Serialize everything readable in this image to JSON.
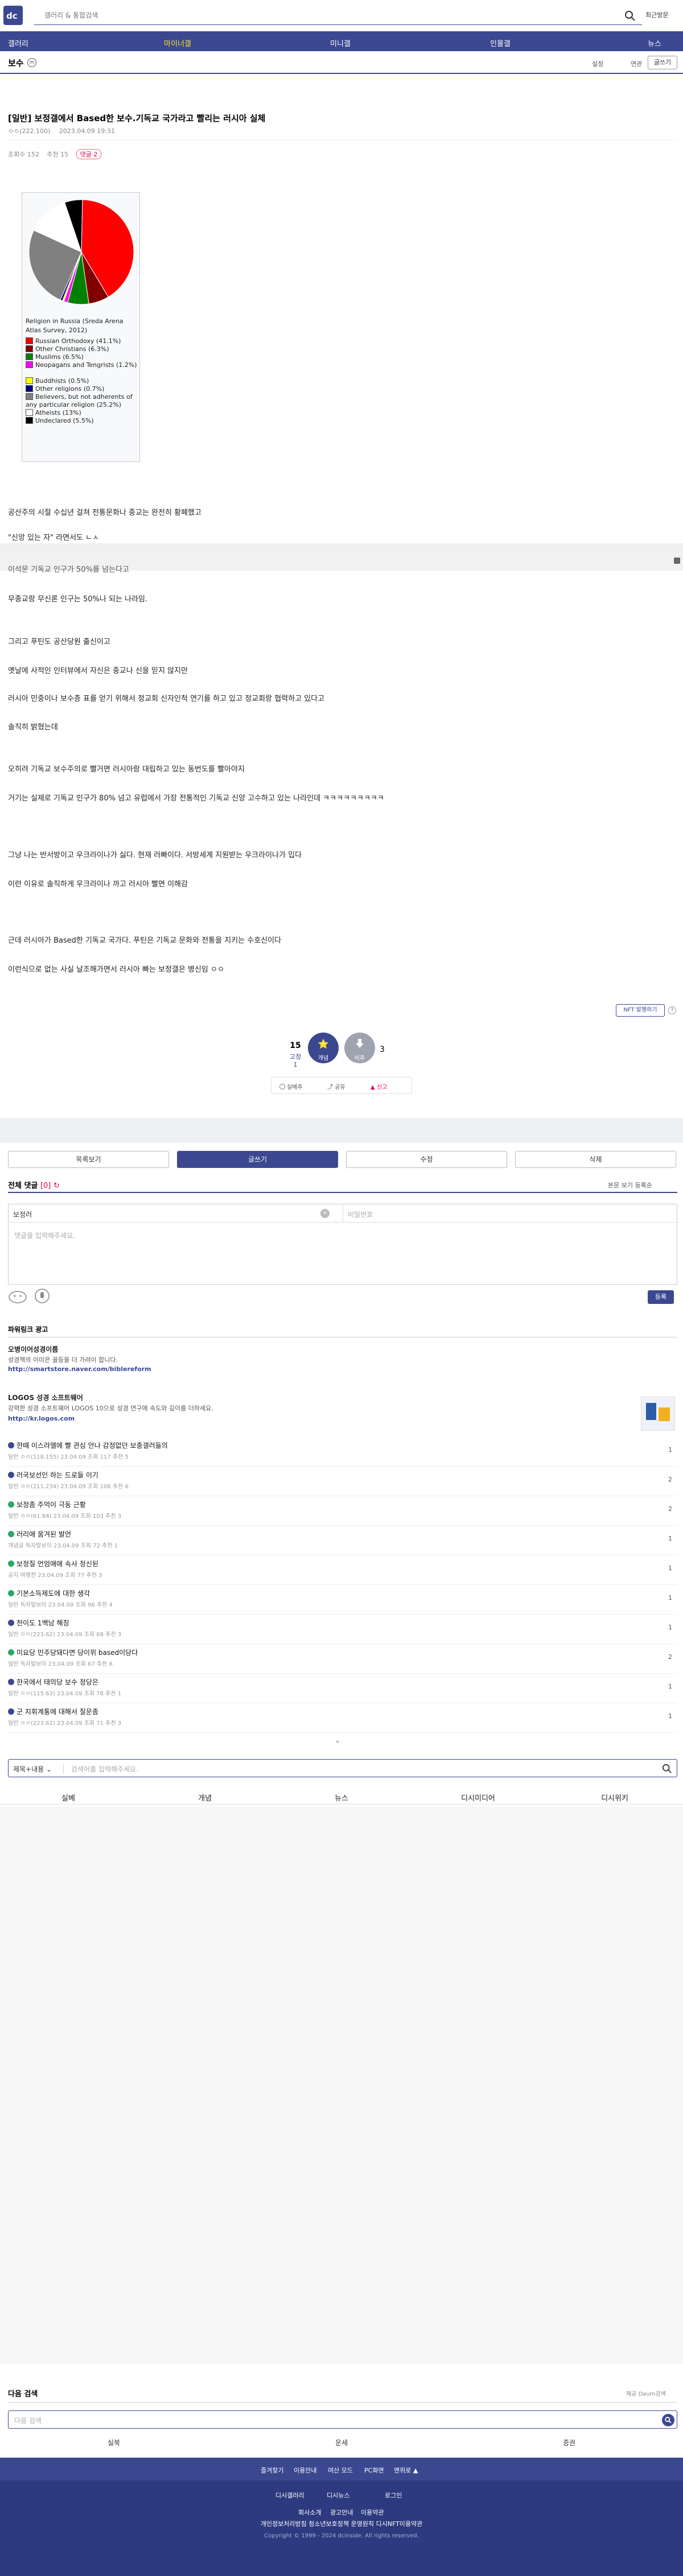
{
  "header": {
    "search_placeholder": "갤러리 & 통합검색",
    "recent": "최근방문"
  },
  "nav": [
    "갤러리",
    "마이너갤",
    "미니갤",
    "인물갤",
    "뉴스"
  ],
  "gallery": {
    "name": "보수",
    "setting": "설정",
    "view_mode": "연관",
    "write": "글쓰기"
  },
  "post": {
    "title": "[일반] 보정갤에서 Based한 보수.기독교 국가라고 빨리는 러시아 실체",
    "author": "ㅇㅇ(222.100)",
    "date": "2023.04.09 19:31",
    "views": "조회수 152",
    "recommend": "추천 15",
    "comments_chip": "댓글 2"
  },
  "figure": {
    "caption": "Religion in Russia (Sreda Arena Atlas Survey, 2012)",
    "legend": [
      {
        "label": "Russian Orthodoxy (41.1%)",
        "color": "#ff0000"
      },
      {
        "label": "Other Christians (6.3%)",
        "color": "#800000"
      },
      {
        "label": "Muslims (6.5%)",
        "color": "#008000"
      },
      {
        "label": "Neopagans and Tengrists (1.2%)",
        "color": "#ff00ff"
      },
      {
        "label": "Buddhists (0.5%)",
        "color": "#ffff00"
      },
      {
        "label": "Other religions (0.7%)",
        "color": "#000080"
      },
      {
        "label": "Believers, but not adherents of any particular religion (25.2%)",
        "color": "#808080"
      },
      {
        "label": "Atheists (13%)",
        "color": "#ffffff"
      },
      {
        "label": "Undeclared (5.5%)",
        "color": "#000000"
      }
    ]
  },
  "body": [
    "공산주의 시절 수십년 걸쳐 전통문화나 종교는 완전히 황폐했고",
    "\"신앙 있는 자\" 라면서도 ㄴㅅ",
    "이석문 기독교 인구가 50%를 넘는다고",
    "무종교랑 무신론 인구는 50%나 되는 나라임.",
    "그리고 푸틴도 공산당원 출신이고",
    "옛날에 사적인 인터뷰에서 자신은 종교나 신을 믿지 않지만",
    "러시아 민중이나 보수층 표를 얻기 위해서 정교회 신자인척 연기를 하고 있고 정교회랑 협력하고 있다고",
    "솔직히 밝혔는데",
    "오히려 기독교 보수주의로 빨거면 러시아랑 대립하고 있는 동번도를 빨아야지",
    "거기는 실제로 기독교 인구가 80% 넘고 유럽에서 가장 전통적인 기독교 신앙 고수하고 있는 나라인데 ㅋㅋㅋㅋㅋㅋㅋㅋㅋ",
    "그냥 나는 반서방이고 우크라이나가 싫다. 현재 러빠이다. 서방세계 지원받는 우크라이나가 밉다",
    "이런 이유로 솔직하게 우크라이나 까고 러시아 빨면 이해감",
    "근데 러시아가 Based한 기독교 국가다. 푸틴은 기독교 문화와 전통을 지키는 수호신이다",
    "이런식으로 없는 사실 날조해가면서 러시아 빠는 보정갤은 병신임 ㅇㅇ"
  ],
  "actions": {
    "nft": "NFT 발행하기",
    "up_count": "15",
    "up_fixed": "고정 1",
    "up_label": "개념",
    "down_label": "비추",
    "down_count": "3",
    "share": "공유",
    "report": "신고",
    "scrap": "실베추",
    "list": "목록보기",
    "write": "글쓰기",
    "edit": "수정",
    "delete": "삭제"
  },
  "comments": {
    "title": "전체 댓글",
    "count": "[0]",
    "tools": "본문 보기  등록순",
    "nick": "보정러",
    "pw_placeholder": "비밀번호",
    "body_placeholder": "댓글을 입력해주세요.",
    "submit": "등록"
  },
  "powerlink": {
    "title": "파워링크 광고",
    "ads": [
      {
        "name": "오병이어성경이름",
        "desc": "성경책의 이미은 꼴등을 더 가려이 합니다.",
        "url": "http://smartstore.naver.com/biblereform"
      },
      {
        "name": "LOGOS 성경 소프트웨어",
        "desc": "강력한 성경 소프트웨어 LOGOS 10으로 성경 연구에 속도와 깊이를 더하세요.",
        "url": "http://kr.logos.com"
      }
    ]
  },
  "related_posts": [
    {
      "title": "한때 이스라엘에 빨 관심 안나 감정없던 보충갤러들의",
      "meta": "일반  ㅇㅇ(118.155)  23.04.09  조회 117  추천 5",
      "count": "1",
      "dot": "#3b4890"
    },
    {
      "title": "러국보선인 하는 드로들 이기",
      "meta": "일반  ㅇㅇ(211.234)  23.04.09  조회 106  추천 6",
      "count": "2",
      "dot": "#3b4890"
    },
    {
      "title": "보정좀 주먹이 극동 근황",
      "meta": "일반  ㅇㅇ(61.84)  23.04.09  조회 103  추천 3",
      "count": "2",
      "dot": "#2aa866"
    },
    {
      "title": "러리애 움겨된 발언",
      "meta": "개념글  독자발보이  23.04.09  조회 72  추천 1",
      "count": "1",
      "dot": "#2aa866"
    },
    {
      "title": "보정질 언엄애애 속사 정신된",
      "meta": "공지  여행전  23.04.09  조회 77  추천 3",
      "count": "1",
      "dot": "#2aa866"
    },
    {
      "title": "기본소득제도에 대한 생각",
      "meta": "일반  독자발보이  23.04.09  조회 96  추천 4",
      "count": "1",
      "dot": "#2aa866"
    },
    {
      "title": "천이도 1백남 해칭",
      "meta": "일반  ㅇㅇ(223.62)  23.04.09  조회 68  추천 3",
      "count": "1",
      "dot": "#3b4890"
    },
    {
      "title": "미요당 민주당돼다면 당이위 based이당다",
      "meta": "일반  독자발보이  23.04.09  조회 67  추천 6",
      "count": "2",
      "dot": "#2aa866"
    },
    {
      "title": "한국에서 태의당 보수 정당은",
      "meta": "일반  ㅇㅇ(115.63)  23.04.09  조회 78  추천 1",
      "count": "1",
      "dot": "#3b4890"
    },
    {
      "title": "군 지휘계통에 대해서 질문좀",
      "meta": "일반  ㅇㅇ(223.62)  23.04.09  조회 71  추천 3",
      "count": "1",
      "dot": "#3b4890"
    }
  ],
  "board_search": {
    "select": "제목+내용",
    "placeholder": "검색어를 입력해주세요."
  },
  "categories": [
    "실베",
    "개념",
    "뉴스",
    "디시미디어",
    "디시위키"
  ],
  "related_search": {
    "title": "다음 검색",
    "daum": "제공 Daum검색",
    "placeholder": "다음 검색",
    "tabs": [
      "실북",
      "운세",
      "증권"
    ]
  },
  "footer": {
    "row1": [
      "즐겨찾기",
      "이용안내",
      "여산 모드",
      "PC화면",
      "맨위로 ▲"
    ],
    "row2": [
      "디시갤러리",
      "디시뉴스",
      "로그인"
    ],
    "row3": [
      "회사소개",
      "광고안내",
      "이용약관"
    ],
    "row4": "개인정보처리방침  청소년보호정책  운영원칙  디시NFT이용약관",
    "copyright": "Copyright © 1999 - 2024 dcinside. All rights reserved."
  },
  "colors": {
    "brand": "#3b4890",
    "accent": "#ffe034"
  }
}
